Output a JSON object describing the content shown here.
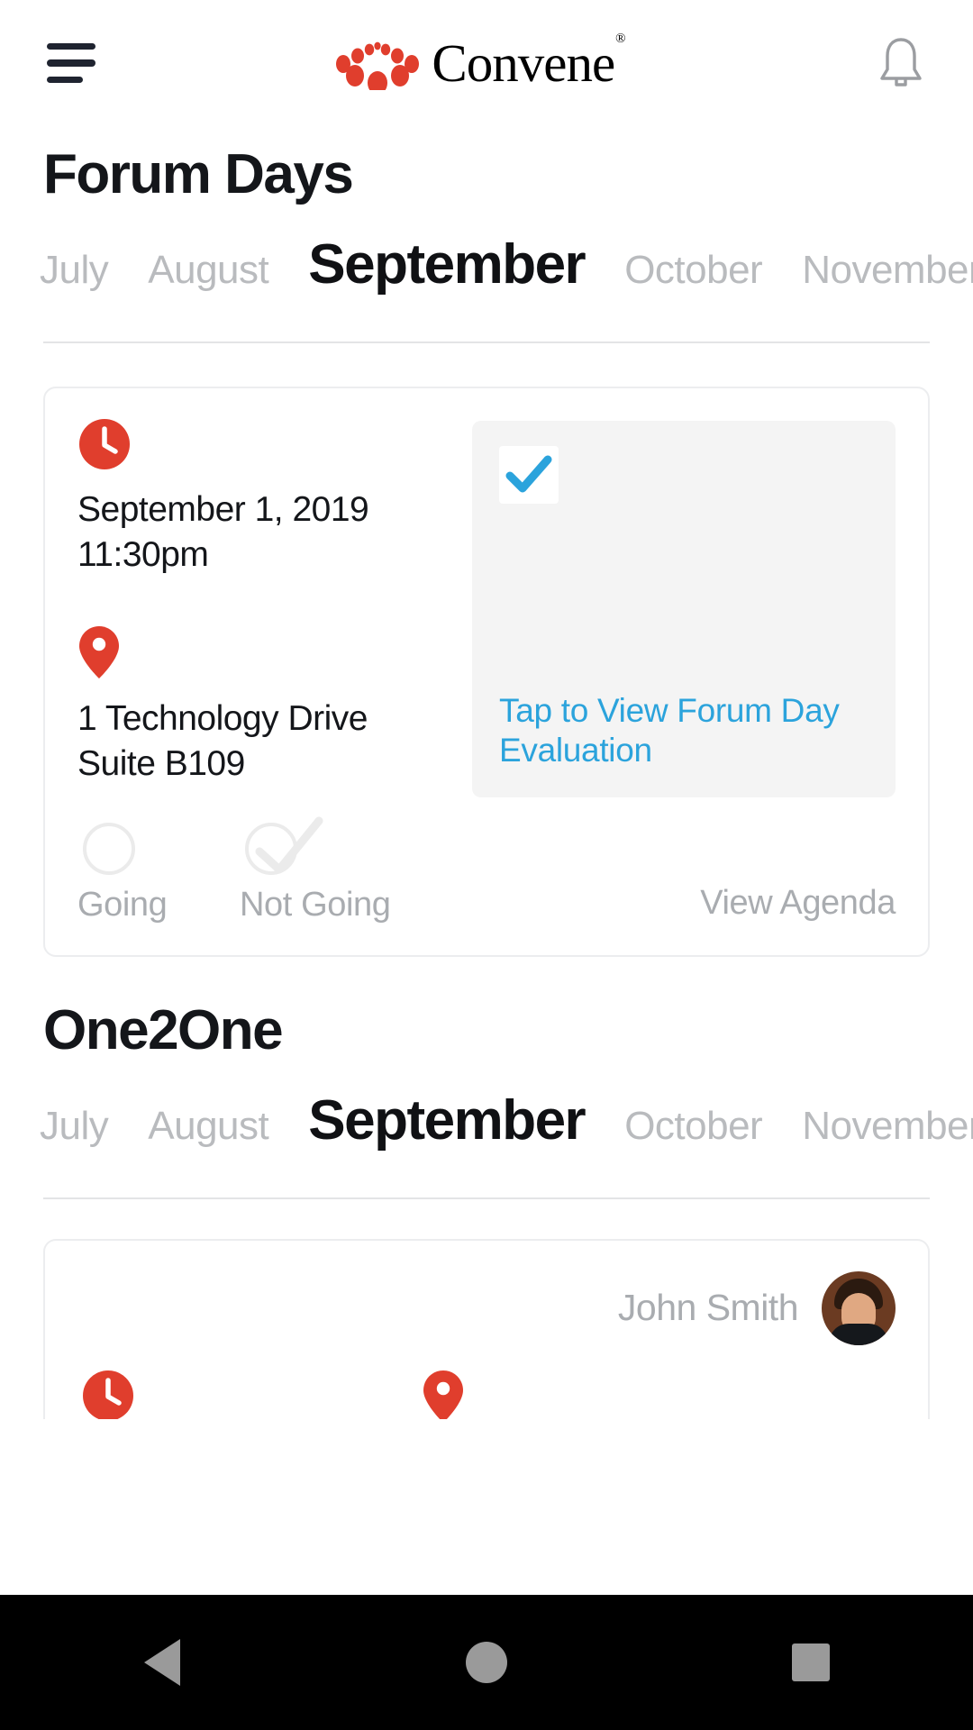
{
  "header": {
    "menu_icon": "hamburger-menu-icon",
    "brand_name": "Convene",
    "brand_trademark": "®",
    "brand_mark_icon": "convene-dots-logo-icon",
    "notification_icon": "bell-icon"
  },
  "forum_days": {
    "title": "Forum Days",
    "months": [
      {
        "label": "July",
        "active": false
      },
      {
        "label": "August",
        "active": false
      },
      {
        "label": "September",
        "active": true
      },
      {
        "label": "October",
        "active": false
      },
      {
        "label": "November",
        "active": false
      }
    ],
    "card": {
      "clock_icon": "clock-icon",
      "date": "September 1, 2019",
      "time": "11:30pm",
      "pin_icon": "location-pin-icon",
      "address_line1": "1 Technology Drive",
      "address_line2": "Suite B109",
      "evaluation": {
        "check_icon": "checkmark-icon",
        "link_text": "Tap to View Forum Day Evaluation"
      },
      "rsvp": {
        "going_label": "Going",
        "going_selected": false,
        "not_going_label": "Not Going",
        "not_going_selected": true
      },
      "view_agenda_label": "View Agenda"
    }
  },
  "one2one": {
    "title": "One2One",
    "months": [
      {
        "label": "July",
        "active": false
      },
      {
        "label": "August",
        "active": false
      },
      {
        "label": "September",
        "active": true
      },
      {
        "label": "October",
        "active": false
      },
      {
        "label": "November",
        "active": false
      }
    ],
    "card": {
      "person_name": "John Smith",
      "avatar_icon": "user-avatar",
      "clock_icon": "clock-icon",
      "pin_icon": "location-pin-icon"
    }
  },
  "system_nav": {
    "back_label": "Back",
    "home_label": "Home",
    "recents_label": "Recents"
  },
  "colors": {
    "accent_red": "#E03E2D",
    "link_blue": "#2BA3DC",
    "muted_gray": "#A9ACB0",
    "panel_gray": "#F4F4F4"
  }
}
